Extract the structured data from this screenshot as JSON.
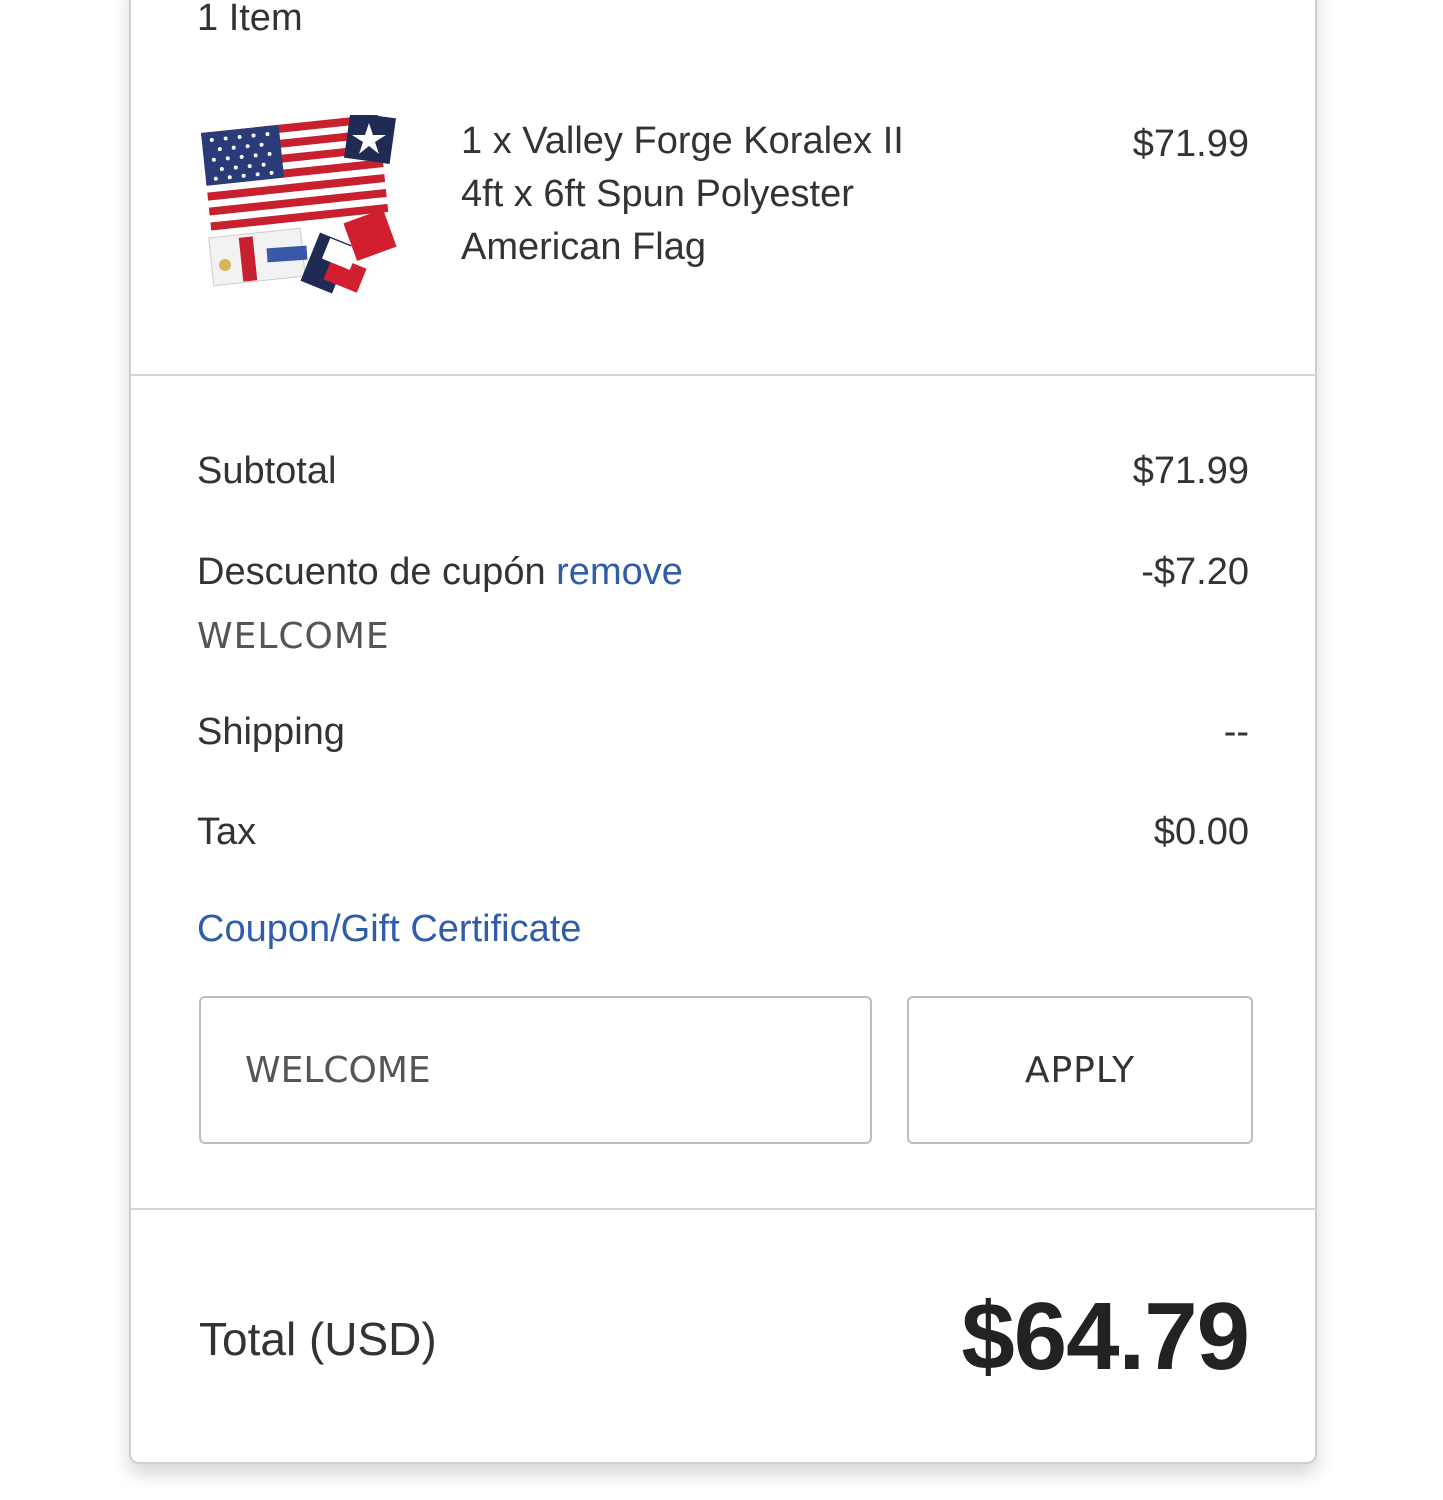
{
  "cart": {
    "item_count": "1 Item",
    "items": [
      {
        "name_line1": "1 x Valley Forge Koralex II",
        "name_line2": "4ft x 6ft Spun Polyester",
        "name_line3": "American Flag",
        "price": "$71.99"
      }
    ]
  },
  "totals": {
    "subtotal_label": "Subtotal",
    "subtotal_value": "$71.99",
    "discount_label": "Descuento de cupón",
    "discount_remove": "remove",
    "discount_value": "-$7.20",
    "coupon_code": "WELCOME",
    "shipping_label": "Shipping",
    "shipping_value": "--",
    "tax_label": "Tax",
    "tax_value": "$0.00",
    "coupon_link": "Coupon/Gift Certificate"
  },
  "coupon_form": {
    "input_value": "WELCOME",
    "apply_label": "APPLY"
  },
  "grand_total": {
    "label": "Total (USD)",
    "value": "$64.79"
  },
  "colors": {
    "link": "#2f5daa",
    "border": "#cfcfcf",
    "text": "#333333"
  }
}
